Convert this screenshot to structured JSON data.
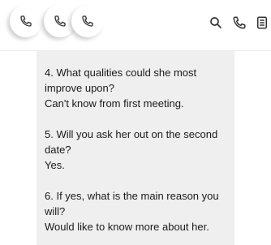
{
  "toolbar": {
    "left_icons": [
      "phone-icon",
      "phone-icon",
      "phone-icon"
    ],
    "right_icons": [
      "search-icon",
      "phone-icon",
      "document-icon"
    ]
  },
  "qa": [
    {
      "question": "4.  What qualities could she most improve upon?",
      "answer": "Can't know from first meeting."
    },
    {
      "question": "5.  Will you ask her out on the second date?",
      "answer": "Yes."
    },
    {
      "question": "6.  If yes, what is the main reason you will?",
      "answer": "Would like to know more about her."
    }
  ]
}
